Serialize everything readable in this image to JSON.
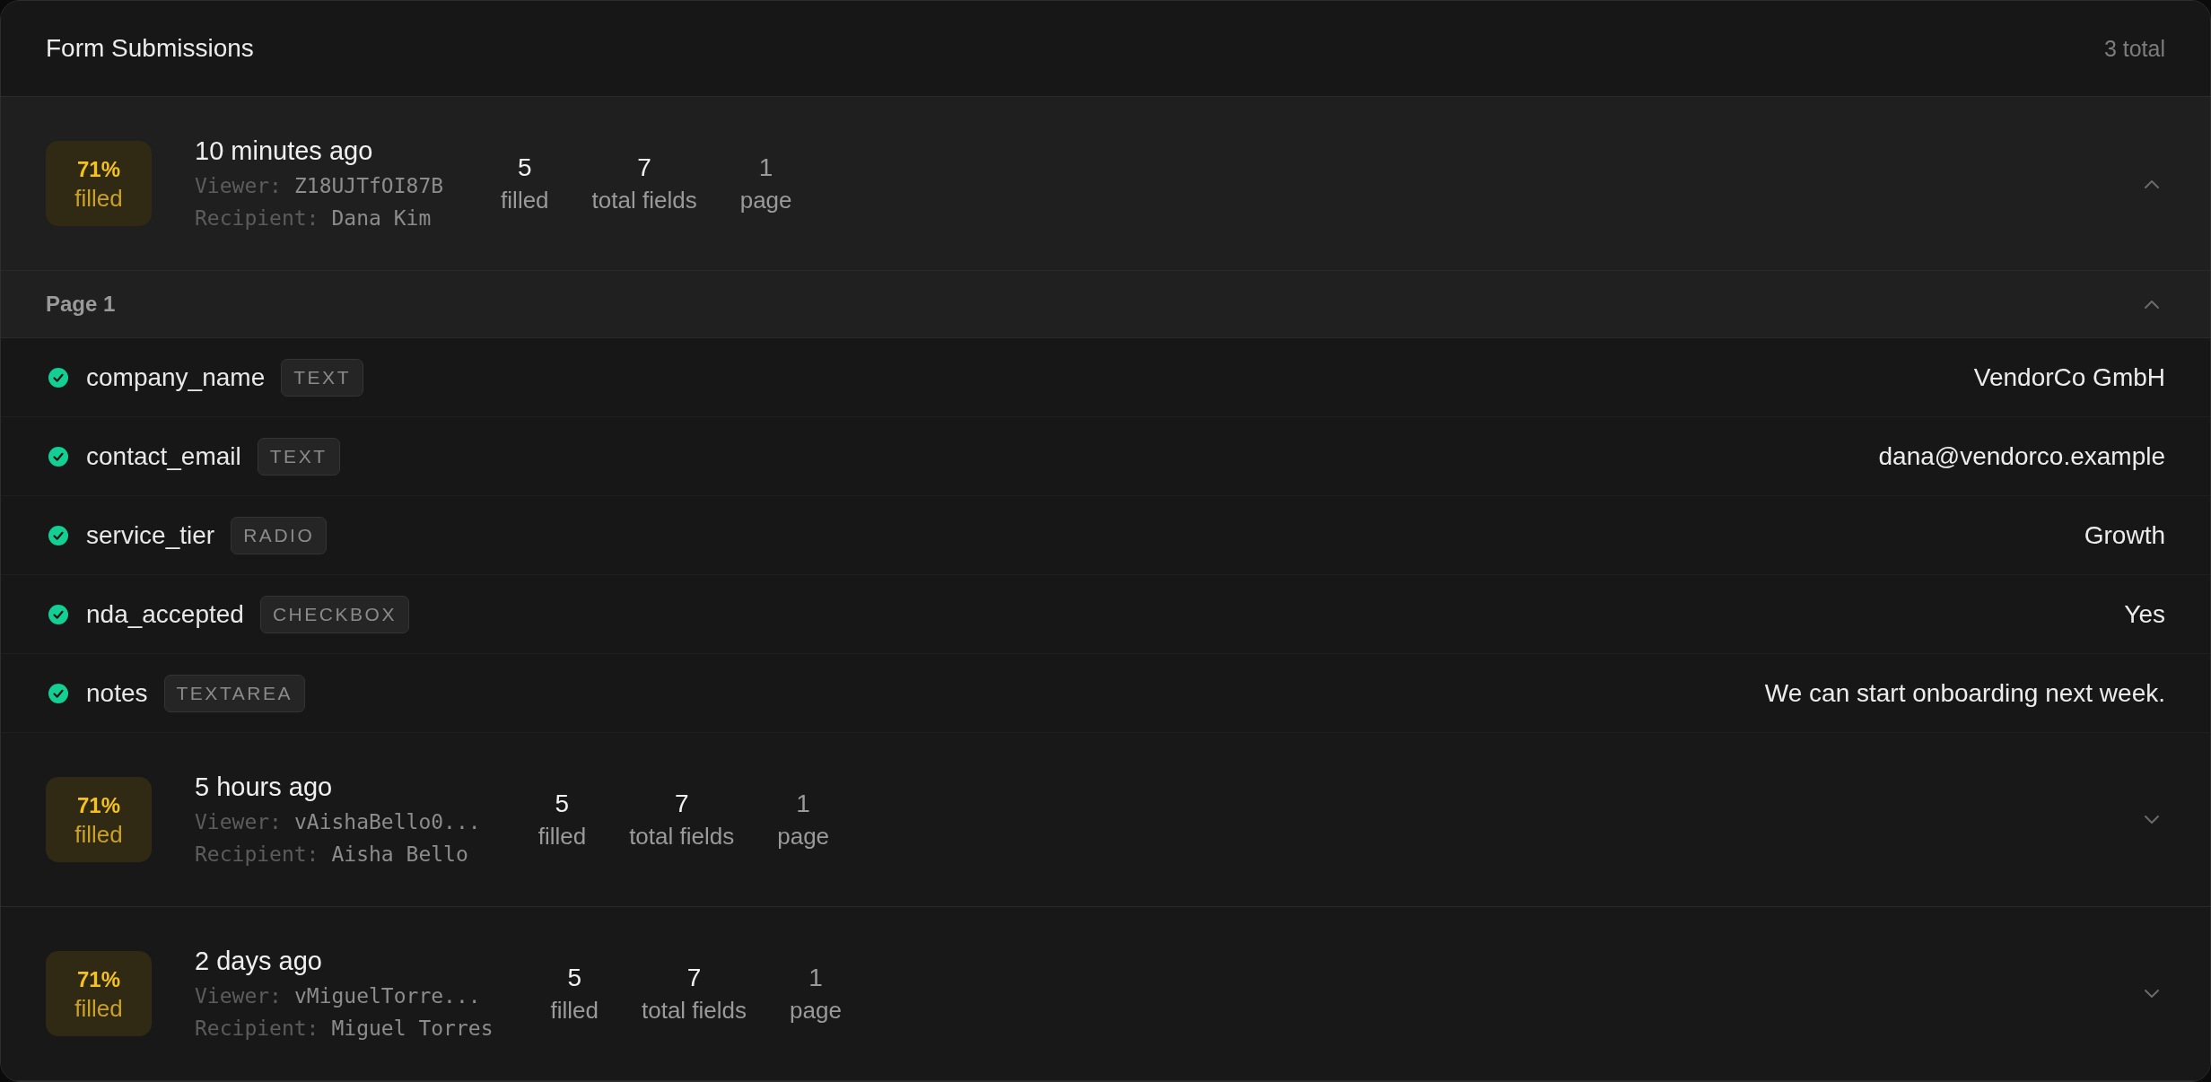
{
  "header": {
    "title": "Form Submissions",
    "count": "3 total"
  },
  "submissions": [
    {
      "expanded": true,
      "percent": "71%",
      "percent_label": "filled",
      "time": "10 minutes ago",
      "viewer_label": "Viewer:",
      "viewer": "Z18UJTfOI87B",
      "recipient_label": "Recipient:",
      "recipient": "Dana Kim",
      "stats": [
        {
          "value": "5",
          "label": "filled",
          "muted": false
        },
        {
          "value": "7",
          "label": "total fields",
          "muted": false
        },
        {
          "value": "1",
          "label": "page",
          "muted": true
        }
      ],
      "pages": [
        {
          "title": "Page 1",
          "expanded": true,
          "fields": [
            {
              "name": "company_name",
              "type": "TEXT",
              "value": "VendorCo GmbH",
              "filled": true
            },
            {
              "name": "contact_email",
              "type": "TEXT",
              "value": "dana@vendorco.example",
              "filled": true
            },
            {
              "name": "service_tier",
              "type": "RADIO",
              "value": "Growth",
              "filled": true
            },
            {
              "name": "nda_accepted",
              "type": "CHECKBOX",
              "value": "Yes",
              "filled": true
            },
            {
              "name": "notes",
              "type": "TEXTAREA",
              "value": "We can start onboarding next week.",
              "filled": true
            }
          ]
        }
      ]
    },
    {
      "expanded": false,
      "percent": "71%",
      "percent_label": "filled",
      "time": "5 hours ago",
      "viewer_label": "Viewer:",
      "viewer": "vAishaBello0...",
      "recipient_label": "Recipient:",
      "recipient": "Aisha Bello",
      "stats": [
        {
          "value": "5",
          "label": "filled",
          "muted": false
        },
        {
          "value": "7",
          "label": "total fields",
          "muted": false
        },
        {
          "value": "1",
          "label": "page",
          "muted": true
        }
      ]
    },
    {
      "expanded": false,
      "percent": "71%",
      "percent_label": "filled",
      "time": "2 days ago",
      "viewer_label": "Viewer:",
      "viewer": "vMiguelTorre...",
      "recipient_label": "Recipient:",
      "recipient": "Miguel Torres",
      "stats": [
        {
          "value": "5",
          "label": "filled",
          "muted": false
        },
        {
          "value": "7",
          "label": "total fields",
          "muted": false
        },
        {
          "value": "1",
          "label": "page",
          "muted": true
        }
      ]
    }
  ]
}
